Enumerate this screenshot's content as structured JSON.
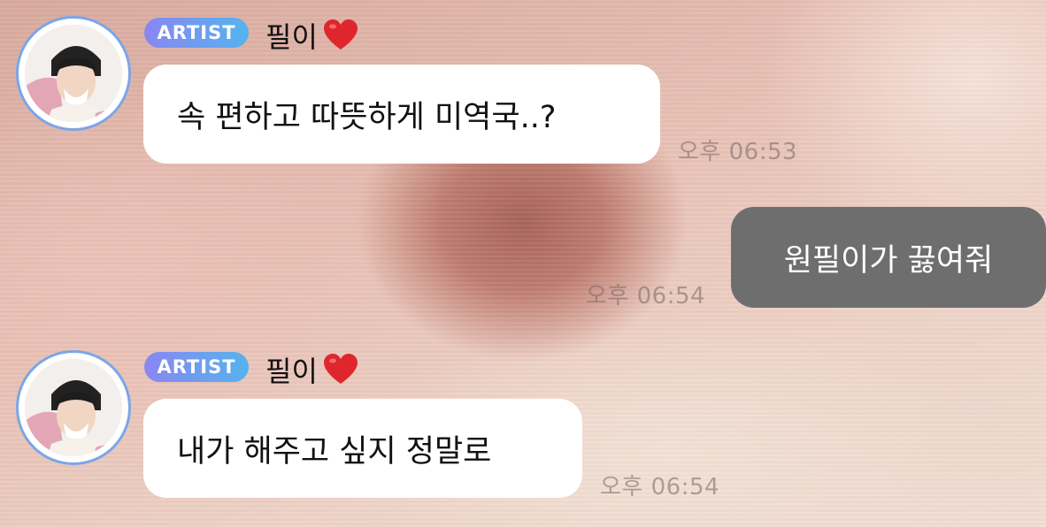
{
  "messages": [
    {
      "sender": "artist",
      "badge": "ARTIST",
      "name": "필이",
      "name_icon": "heart-icon",
      "text": "속 편하고 따뜻하게 미역국..?",
      "time": "오후 06:53"
    },
    {
      "sender": "me",
      "text": "원필이가 끓여줘",
      "time": "오후 06:54"
    },
    {
      "sender": "artist",
      "badge": "ARTIST",
      "name": "필이",
      "name_icon": "heart-icon",
      "text": "내가 해주고 싶지 정말로",
      "time": "오후 06:54"
    }
  ],
  "colors": {
    "badge_start": "#8a86f2",
    "badge_end": "#55b3ee",
    "avatar_ring": "#7aa6e6",
    "my_bubble": "#6e6e6e",
    "heart": "#e0262d"
  }
}
